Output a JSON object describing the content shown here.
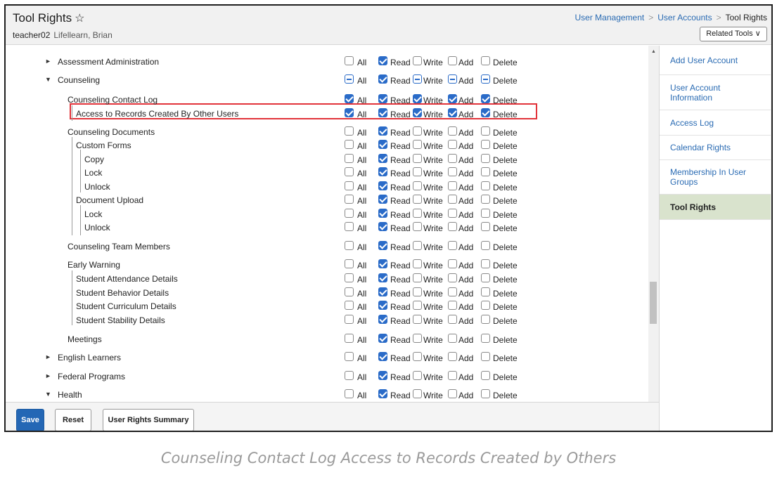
{
  "header": {
    "title": "Tool Rights",
    "star": "☆",
    "user_id": "teacher02",
    "user_name": "Lifellearn, Brian",
    "breadcrumb": [
      "User Management",
      "User Accounts",
      "Tool Rights"
    ],
    "breadcrumb_sep": ">",
    "related_tools": "Related Tools ∨"
  },
  "columns": [
    "All",
    "Read",
    "Write",
    "Add",
    "Delete"
  ],
  "rows": [
    {
      "label": "Assessment Administration",
      "arrow": "►",
      "checks": [
        "off",
        "on",
        "off",
        "off",
        "off"
      ]
    },
    {
      "label": "Counseling",
      "arrow": "▼",
      "checks": [
        "part",
        "on",
        "part",
        "part",
        "part"
      ]
    },
    {
      "label": "Counseling Contact Log",
      "checks": [
        "on",
        "on",
        "on",
        "on",
        "on"
      ]
    },
    {
      "label": "Access to Records Created By Other Users",
      "checks": [
        "on",
        "on",
        "on",
        "on",
        "on"
      ]
    },
    {
      "label": "Counseling Documents",
      "checks": [
        "off",
        "on",
        "off",
        "off",
        "off"
      ]
    },
    {
      "label": "Custom Forms",
      "checks": [
        "off",
        "on",
        "off",
        "off",
        "off"
      ]
    },
    {
      "label": "Copy",
      "checks": [
        "off",
        "on",
        "off",
        "off",
        "off"
      ]
    },
    {
      "label": "Lock",
      "checks": [
        "off",
        "on",
        "off",
        "off",
        "off"
      ]
    },
    {
      "label": "Unlock",
      "checks": [
        "off",
        "on",
        "off",
        "off",
        "off"
      ]
    },
    {
      "label": "Document Upload",
      "checks": [
        "off",
        "on",
        "off",
        "off",
        "off"
      ]
    },
    {
      "label": "Lock",
      "checks": [
        "off",
        "on",
        "off",
        "off",
        "off"
      ]
    },
    {
      "label": "Unlock",
      "checks": [
        "off",
        "on",
        "off",
        "off",
        "off"
      ]
    },
    {
      "label": "Counseling Team Members",
      "checks": [
        "off",
        "on",
        "off",
        "off",
        "off"
      ]
    },
    {
      "label": "Early Warning",
      "checks": [
        "off",
        "on",
        "off",
        "off",
        "off"
      ]
    },
    {
      "label": "Student Attendance Details",
      "checks": [
        "off",
        "on",
        "off",
        "off",
        "off"
      ]
    },
    {
      "label": "Student Behavior Details",
      "checks": [
        "off",
        "on",
        "off",
        "off",
        "off"
      ]
    },
    {
      "label": "Student Curriculum Details",
      "checks": [
        "off",
        "on",
        "off",
        "off",
        "off"
      ]
    },
    {
      "label": "Student Stability Details",
      "checks": [
        "off",
        "on",
        "off",
        "off",
        "off"
      ]
    },
    {
      "label": "Meetings",
      "checks": [
        "off",
        "on",
        "off",
        "off",
        "off"
      ]
    },
    {
      "label": "English Learners",
      "arrow": "►",
      "checks": [
        "off",
        "on",
        "off",
        "off",
        "off"
      ]
    },
    {
      "label": "Federal Programs",
      "arrow": "►",
      "checks": [
        "off",
        "on",
        "off",
        "off",
        "off"
      ]
    },
    {
      "label": "Health",
      "arrow": "▼",
      "checks": [
        "off",
        "on",
        "off",
        "off",
        "off"
      ]
    }
  ],
  "sidebar": {
    "items": [
      {
        "label": "Add User Account",
        "active": false
      },
      {
        "label": "User Account Information",
        "active": false
      },
      {
        "label": "Access Log",
        "active": false
      },
      {
        "label": "Calendar Rights",
        "active": false
      },
      {
        "label": "Membership In User Groups",
        "active": false
      },
      {
        "label": "Tool Rights",
        "active": true
      }
    ]
  },
  "footer": {
    "save": "Save",
    "reset": "Reset",
    "summary": "User Rights Summary"
  },
  "caption": "Counseling Contact Log Access to Records Created by Others",
  "colors": {
    "accent": "#2a6bc8",
    "link": "#2a6bb3",
    "highlight_box": "#e2333a",
    "active_sidebar": "#d9e3cd"
  }
}
